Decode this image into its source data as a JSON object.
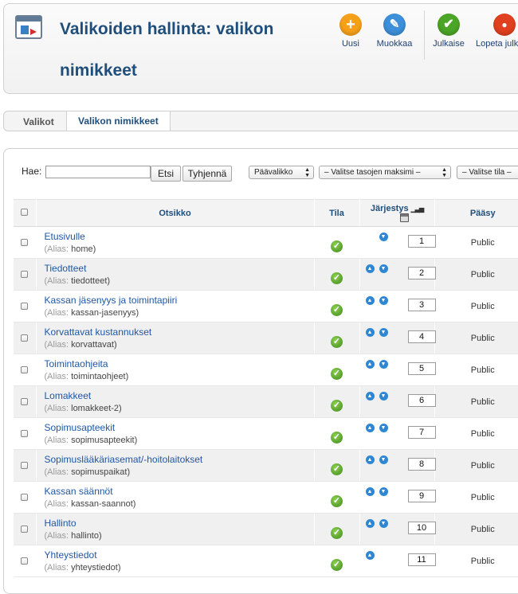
{
  "header": {
    "title": "Valikoiden hallinta: valikon nimikkeet",
    "toolbar": [
      {
        "label": "Uusi",
        "icon": "plus-icon",
        "color": "#f6a01a"
      },
      {
        "label": "Muokkaa",
        "icon": "pencil-icon",
        "color": "#3c8fd8"
      },
      {
        "label": "Julkaise",
        "icon": "check-icon",
        "color": "#4ba526"
      },
      {
        "label": "Lopeta julk",
        "icon": "stop-icon",
        "color": "#e0401f"
      }
    ]
  },
  "tabs": {
    "menus": "Valikot",
    "items": "Valikon nimikkeet"
  },
  "filter": {
    "label": "Hae:",
    "value": "",
    "search_button": "Etsi",
    "clear_button": "Tyhjennä",
    "menu_select": "Päävalikko",
    "level_select": "– Valitse tasojen maksimi –",
    "state_select": "– Valitse tila –"
  },
  "table": {
    "headers": {
      "title": "Otsikko",
      "state": "Tila",
      "order": "Järjestys",
      "access": "Pääsy"
    },
    "alias_prefix": "(Alias:",
    "rows": [
      {
        "title": "Etusivulle",
        "alias": "home",
        "order": "1",
        "access": "Public"
      },
      {
        "title": "Tiedotteet",
        "alias": "tiedotteet",
        "order": "2",
        "access": "Public"
      },
      {
        "title": "Kassan jäsenyys ja toimintapiiri",
        "alias": "kassan-jasenyys",
        "order": "3",
        "access": "Public"
      },
      {
        "title": "Korvattavat kustannukset",
        "alias": "korvattavat",
        "order": "4",
        "access": "Public"
      },
      {
        "title": "Toimintaohjeita",
        "alias": "toimintaohjeet",
        "order": "5",
        "access": "Public"
      },
      {
        "title": "Lomakkeet",
        "alias": "lomakkeet-2",
        "order": "6",
        "access": "Public"
      },
      {
        "title": "Sopimusapteekit",
        "alias": "sopimusapteekit",
        "order": "7",
        "access": "Public"
      },
      {
        "title": "Sopimuslääkäriasemat/-hoitolaitokset",
        "alias": "sopimuspaikat",
        "order": "8",
        "access": "Public"
      },
      {
        "title": "Kassan säännöt",
        "alias": "kassan-saannot",
        "order": "9",
        "access": "Public"
      },
      {
        "title": "Hallinto",
        "alias": "hallinto",
        "order": "10",
        "access": "Public"
      },
      {
        "title": "Yhteystiedot",
        "alias": "yhteystiedot",
        "order": "11",
        "access": "Public"
      }
    ]
  }
}
